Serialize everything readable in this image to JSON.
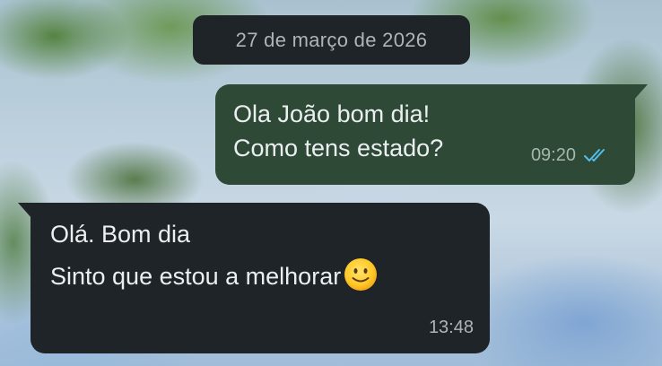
{
  "chat": {
    "date_chip": "27 de março de 2026",
    "messages": [
      {
        "direction": "outgoing",
        "lines": [
          "Ola João bom dia!",
          "Como tens estado?"
        ],
        "time": "09:20",
        "status": "read",
        "status_icon": "double-check-icon",
        "status_color": "#53bdeb",
        "bubble_color": "#2e4a37"
      },
      {
        "direction": "incoming",
        "lines": [
          "Olá. Bom dia",
          "Sinto que estou a melhorar"
        ],
        "emoji": "slightly-smiling-face-icon",
        "time": "13:48",
        "bubble_color": "#1e2428"
      }
    ]
  },
  "colors": {
    "date_chip_bg": "#1e2428",
    "date_chip_text": "#aeb5ba",
    "message_text": "#eceff1"
  }
}
